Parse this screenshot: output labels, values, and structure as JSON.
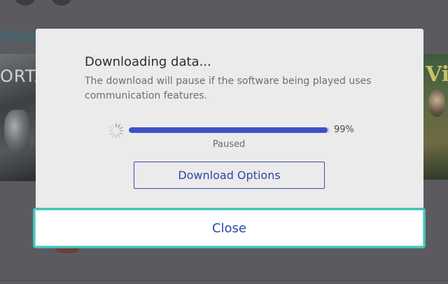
{
  "background": {
    "game_title": "Porta",
    "tile_left_label": "ORTA",
    "tile_right_label": "Vi",
    "scrim_color": "#5b5b5f"
  },
  "dialog": {
    "title": "Downloading data...",
    "message": "The download will pause if the software being played uses communication features.",
    "spinner_icon": "loading-spinner-icon",
    "progress": {
      "value": 0.99,
      "percent_label": "99%",
      "status": "Paused",
      "fill_color": "#3d51c8",
      "track_color": "#cfcfcf"
    },
    "download_options_label": "Download Options",
    "close_label": "Close",
    "focus_color": "#45c3b7",
    "accent_text_color": "#3047a8"
  }
}
